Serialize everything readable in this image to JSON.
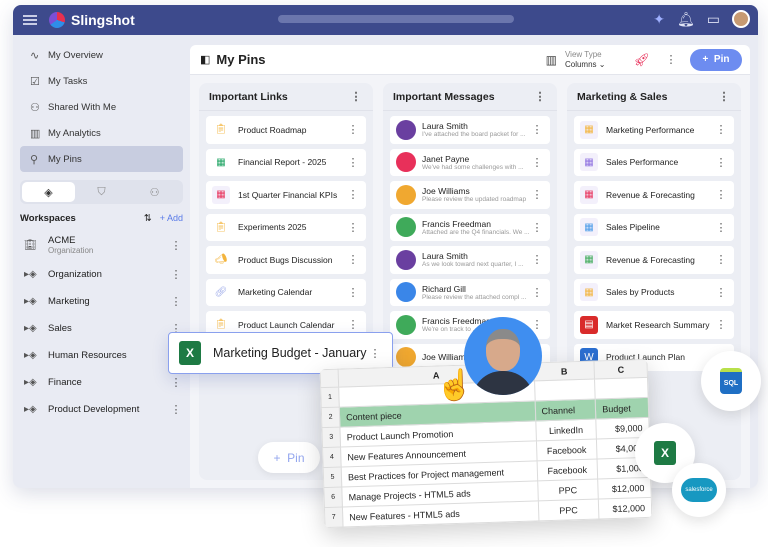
{
  "header": {
    "brand": "Slingshot",
    "icons": [
      "menu-icon",
      "sparkle-icon",
      "bell-icon",
      "chat-icon",
      "user-avatar"
    ]
  },
  "sidebar": {
    "nav": [
      {
        "label": "My Overview",
        "icon": "pulse-icon"
      },
      {
        "label": "My Tasks",
        "icon": "clipboard-icon"
      },
      {
        "label": "Shared With Me",
        "icon": "shared-user-icon"
      },
      {
        "label": "My Analytics",
        "icon": "bar-chart-icon"
      },
      {
        "label": "My Pins",
        "icon": "pin-icon",
        "active": true
      }
    ],
    "workspaces_title": "Workspaces",
    "add_label": "Add",
    "org": {
      "name": "ACME",
      "type": "Organization"
    },
    "workspaces": [
      "Organization",
      "Marketing",
      "Sales",
      "Human Resources",
      "Finance",
      "Product Development"
    ]
  },
  "main": {
    "title": "My Pins",
    "view_type_label": "View Type",
    "view_type_value": "Columns",
    "pin_button": "Pin",
    "columns": [
      {
        "title": "Important Links",
        "items": [
          {
            "label": "Product Roadmap",
            "icon": "clipboard-icon",
            "color": "#f3b43c"
          },
          {
            "label": "Financial Report - 2025",
            "icon": "sheet-icon",
            "color": "#1fa463"
          },
          {
            "label": "1st Quarter Financial KPIs",
            "icon": "dashboard-icon",
            "color": "#8bc4a0"
          },
          {
            "label": "Experiments 2025",
            "icon": "clipboard-icon",
            "color": "#f3b43c"
          },
          {
            "label": "Product Bugs Discussion",
            "icon": "megaphone-icon",
            "color": "#f3b43c"
          },
          {
            "label": "Marketing Calendar",
            "icon": "link-icon",
            "color": "#9aa8e8"
          },
          {
            "label": "Product Launch Calendar",
            "icon": "clipboard-icon",
            "color": "#f3b43c"
          }
        ]
      },
      {
        "title": "Important Messages",
        "items": [
          {
            "name": "Laura Smith",
            "preview": "I've attached the board packet for ...",
            "color": "#6a3fa0"
          },
          {
            "name": "Janet Payne",
            "preview": "We've had some challenges with ...",
            "color": "#e8305a"
          },
          {
            "name": "Joe Williams",
            "preview": "Please review the updated roadmap",
            "color": "#f0a830"
          },
          {
            "name": "Francis Freedman",
            "preview": "Attached are the Q4 financials. We ...",
            "color": "#3faa5a"
          },
          {
            "name": "Laura Smith",
            "preview": "As we look toward next quarter, I ...",
            "color": "#6a3fa0"
          },
          {
            "name": "Richard Gill",
            "preview": "Please review the attached compl ...",
            "color": "#3a86e8"
          },
          {
            "name": "Francis Freedman",
            "preview": "We're on track to ...",
            "color": "#3faa5a"
          },
          {
            "name": "Joe Williams",
            "preview": "",
            "color": "#f0a830"
          }
        ]
      },
      {
        "title": "Marketing & Sales",
        "items": [
          {
            "label": "Marketing Performance",
            "icon": "dashboard-icon"
          },
          {
            "label": "Sales Performance",
            "icon": "dashboard-icon"
          },
          {
            "label": "Revenue & Forecasting",
            "icon": "dashboard-icon"
          },
          {
            "label": "Sales Pipeline",
            "icon": "dashboard-icon"
          },
          {
            "label": "Revenue & Forecasting",
            "icon": "dashboard-icon"
          },
          {
            "label": "Sales by Products",
            "icon": "dashboard-icon"
          },
          {
            "label": "Market Research Summary",
            "icon": "pdf-icon"
          },
          {
            "label": "Product Launch Plan",
            "icon": "word-icon"
          }
        ]
      }
    ]
  },
  "drag_card": {
    "label": "Marketing Budget - January",
    "icon": "excel-icon"
  },
  "ghost_pin": "Pin",
  "sheet": {
    "columns": [
      "A",
      "B",
      "C"
    ],
    "rows": [
      [
        "",
        "",
        ""
      ],
      [
        "Content piece",
        "Channel",
        "Budget"
      ],
      [
        "Product Launch Promotion",
        "LinkedIn",
        "$9,000"
      ],
      [
        "New Features Announcement",
        "Facebook",
        "$4,000"
      ],
      [
        "Best Practices for Project management",
        "Facebook",
        "$1,000"
      ],
      [
        "Manage Projects - HTML5 ads",
        "PPC",
        "$12,000"
      ],
      [
        "New Features - HTML5 ads",
        "PPC",
        "$12,000"
      ]
    ]
  },
  "badges": {
    "sql": "SQL",
    "excel": "X",
    "salesforce": "salesforce"
  }
}
